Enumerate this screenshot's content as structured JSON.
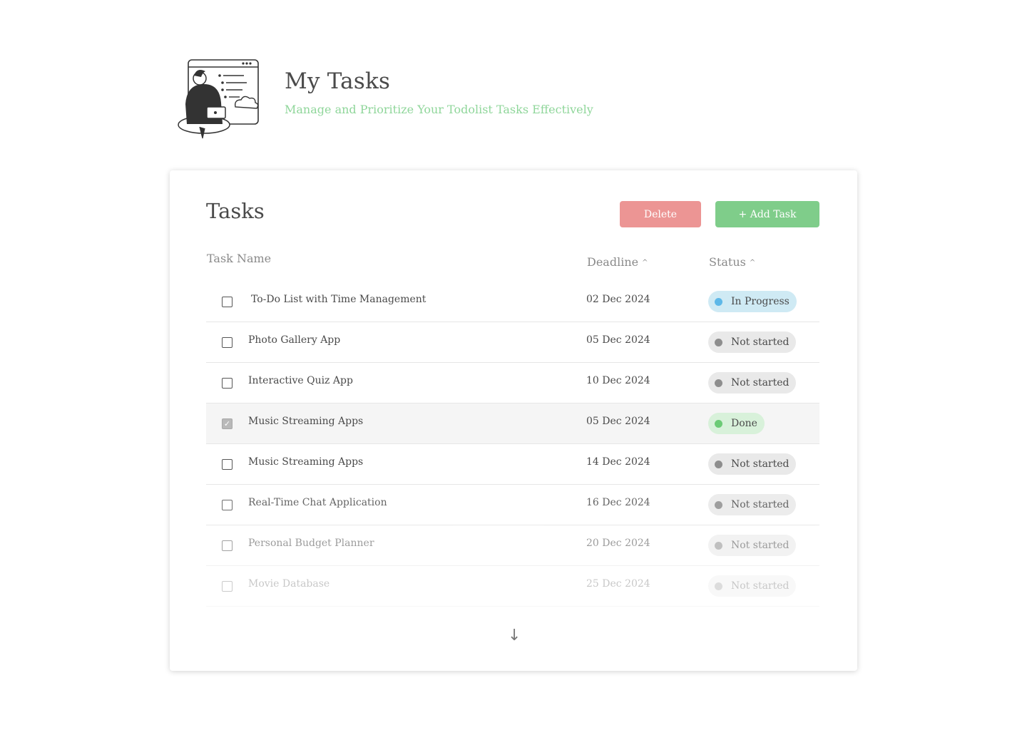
{
  "header": {
    "title": "My Tasks",
    "subtitle": "Manage and Prioritize Your Todolist Tasks Effectively"
  },
  "card": {
    "title": "Tasks",
    "delete_label": "Delete",
    "add_label": "+ Add Task"
  },
  "columns": {
    "name": "Task Name",
    "deadline": "Deadline",
    "status": "Status",
    "sort_glyph": "^"
  },
  "tasks": [
    {
      "name": "To-Do List with Time Management",
      "deadline": "02 Dec 2024",
      "status": "In Progress",
      "checked": false
    },
    {
      "name": "Photo Gallery App",
      "deadline": "05 Dec 2024",
      "status": "Not started",
      "checked": false
    },
    {
      "name": "Interactive Quiz App",
      "deadline": "10 Dec 2024",
      "status": "Not started",
      "checked": false
    },
    {
      "name": "Music Streaming Apps",
      "deadline": "05 Dec 2024",
      "status": "Done",
      "checked": true
    },
    {
      "name": "Music Streaming Apps",
      "deadline": "14 Dec 2024",
      "status": "Not started",
      "checked": false
    },
    {
      "name": "Real-Time Chat Application",
      "deadline": "16 Dec 2024",
      "status": "Not started",
      "checked": false
    },
    {
      "name": "Personal Budget Planner",
      "deadline": "20 Dec 2024",
      "status": "Not started",
      "checked": false
    },
    {
      "name": "Movie Database",
      "deadline": "25 Dec 2024",
      "status": "Not started",
      "checked": false
    }
  ],
  "colors": {
    "delete": "#ec9594",
    "add": "#7fcd8a",
    "in_progress_dot": "#5eb8e8",
    "not_started_dot": "#8e8e8e",
    "done_dot": "#6ccb76",
    "subtitle": "#8fd69a"
  },
  "icons": {
    "scroll": "arrow-down-icon",
    "checkbox_checked": "check-icon"
  }
}
